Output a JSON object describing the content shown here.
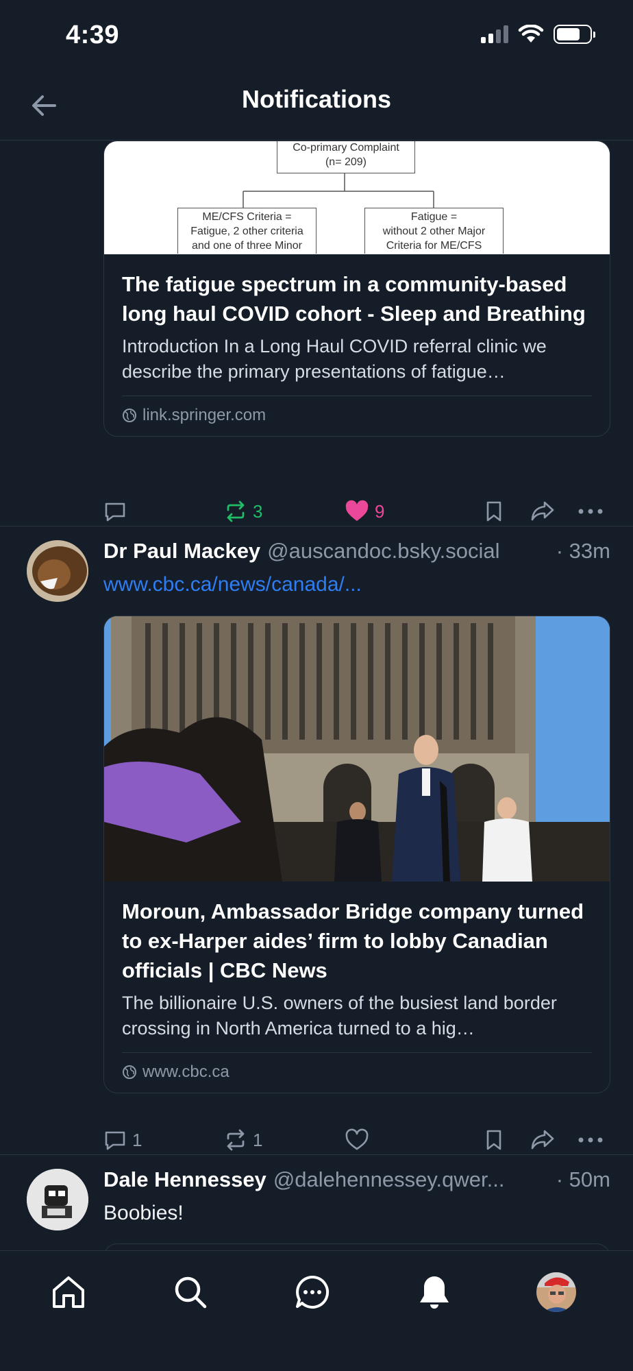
{
  "status": {
    "time": "4:39"
  },
  "header": {
    "title": "Notifications"
  },
  "post1": {
    "diagram": {
      "top_box": [
        "Co-primary Complaint",
        "(n= 209)"
      ],
      "left_box": [
        "ME/CFS Criteria =",
        "Fatigue, 2 other criteria",
        "and one of three Minor"
      ],
      "right_box": [
        "Fatigue =",
        "without 2 other Major",
        "Criteria for ME/CFS"
      ]
    },
    "card_title": "The fatigue spectrum in a community-based long haul COVID cohort - Sleep and Breathing",
    "card_desc": "Introduction In a Long Haul COVID referral clinic we describe the primary presentations of fatigue…",
    "card_domain": "link.springer.com",
    "reposts": "3",
    "likes": "9",
    "colors": {
      "repost_active": "#20bc66",
      "like_active": "#ec4899"
    }
  },
  "post2": {
    "author_name": "Dr Paul Mackey",
    "author_handle": "@auscandoc.bsky.social",
    "time": "· 33m",
    "link_text": "www.cbc.ca/news/canada/...",
    "card_title": "Moroun, Ambassador Bridge company turned to ex-Harper aides’ firm to lobby Canadian officials | CBC News",
    "card_desc": "The billionaire U.S. owners of the busiest land border crossing in North America turned to a hig…",
    "card_domain": "www.cbc.ca",
    "replies": "1",
    "reposts": "1"
  },
  "post3": {
    "author_name": "Dale Hennessey",
    "author_handle": "@dalehennessey.qwer...",
    "time": "· 50m",
    "text": "Boobies!"
  },
  "tabs": [
    "home-icon",
    "search-icon",
    "chat-icon",
    "bell-icon",
    "profile-avatar"
  ],
  "colors": {
    "background": "#151d28",
    "border": "#2a3442",
    "muted": "#8d98a8",
    "link": "#2f7df3"
  }
}
